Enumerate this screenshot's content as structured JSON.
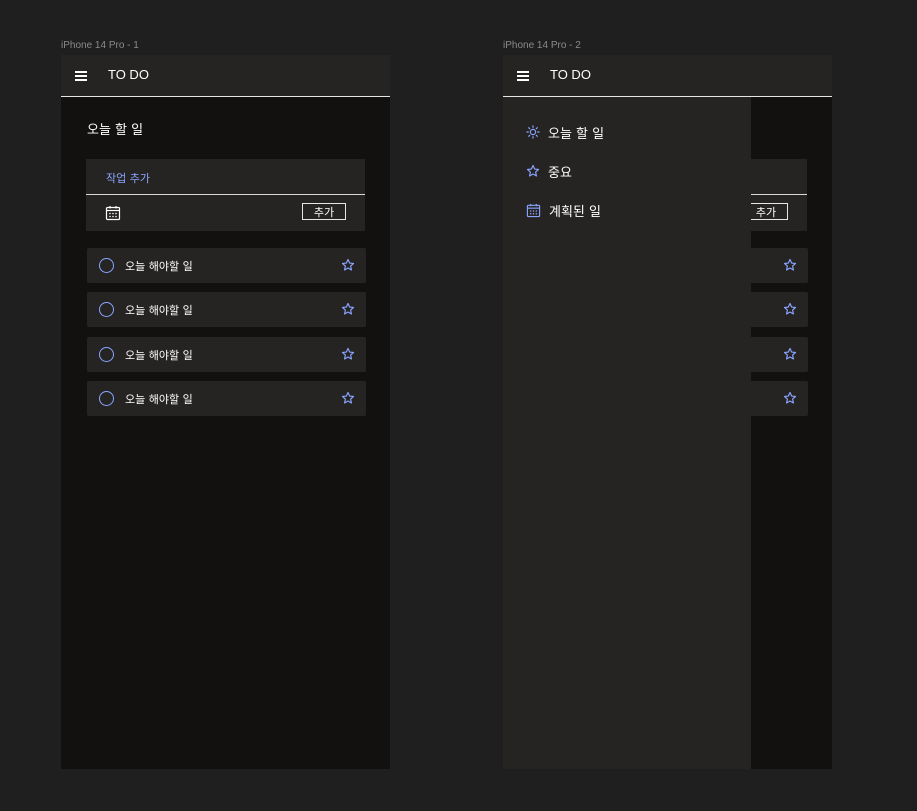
{
  "frames": [
    {
      "label": "iPhone 14 Pro - 1",
      "app_title": "TO DO",
      "page_title": "오늘 할 일",
      "add_task": {
        "placeholder": "작업 추가",
        "add_button": "추가"
      },
      "tasks": [
        {
          "label": "오늘 해야할 일"
        },
        {
          "label": "오늘 해야할 일"
        },
        {
          "label": "오늘 해야할 일"
        },
        {
          "label": "오늘 해야할 일"
        }
      ]
    },
    {
      "label": "iPhone 14 Pro - 2",
      "app_title": "TO DO",
      "add_task": {
        "add_button": "추가"
      },
      "drawer": {
        "items": [
          {
            "icon": "sun-icon",
            "label": "오늘 할 일"
          },
          {
            "icon": "star-icon",
            "label": "중요"
          },
          {
            "icon": "calendar-icon",
            "label": "계획된 일"
          }
        ]
      }
    }
  ],
  "colors": {
    "accent": "#8aa4ff",
    "background": "#1f1f1f",
    "frame_bg": "#121110",
    "card_bg": "#252423"
  }
}
